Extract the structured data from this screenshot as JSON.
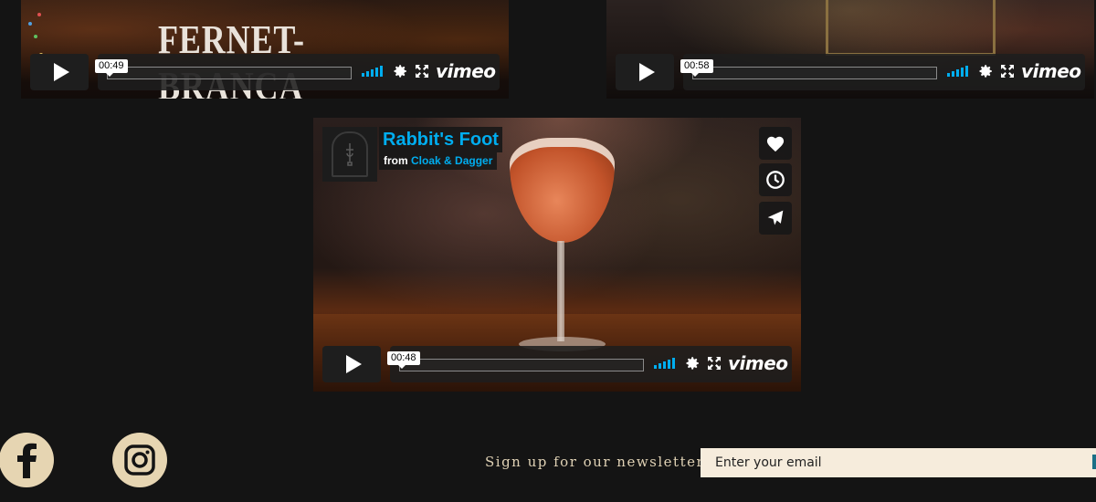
{
  "videos": [
    {
      "id": "fernet",
      "poster_text": "FERNET-BRANCA",
      "timecode": "00:49",
      "brand": "vimeo"
    },
    {
      "id": "second",
      "timecode": "00:58",
      "brand": "vimeo"
    },
    {
      "id": "rabbits-foot",
      "title": "Rabbit's Foot",
      "byline_prefix": "from",
      "channel": "Cloak & Dagger",
      "timecode": "00:48",
      "brand": "vimeo"
    }
  ],
  "side_actions": [
    "heart-icon",
    "clock-icon",
    "paper-plane-icon"
  ],
  "footer": {
    "social": [
      "facebook-icon",
      "instagram-icon"
    ],
    "newsletter_label": "Sign up for our newsletter",
    "email_placeholder": "Enter your email"
  },
  "colors": {
    "background": "#141414",
    "accent": "#00adef",
    "social_bg": "#e6d5b2",
    "newsletter_text": "#e0d2b5",
    "input_bg": "#f6ecdc"
  }
}
